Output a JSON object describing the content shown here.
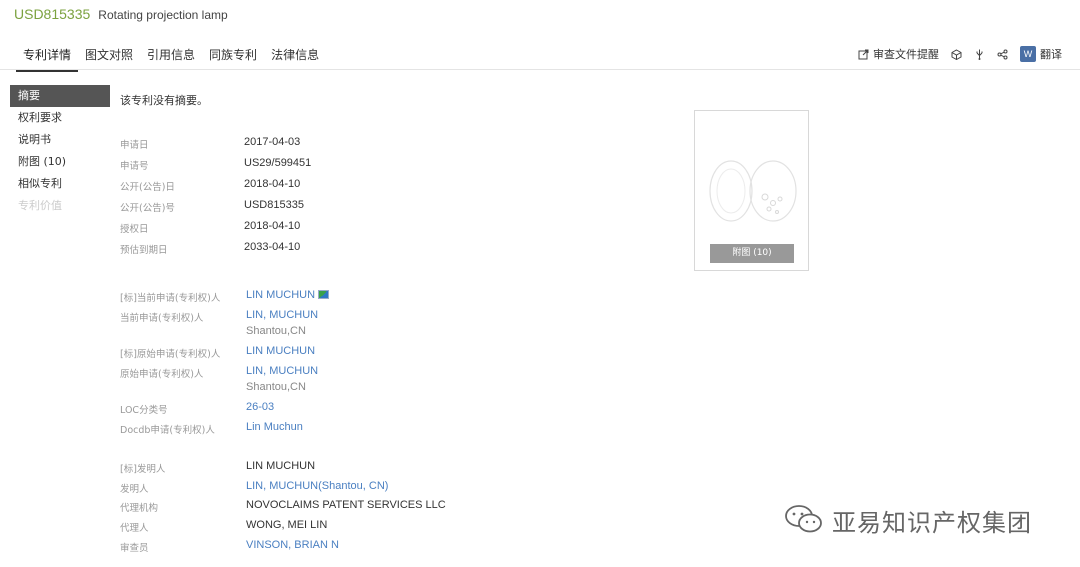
{
  "header": {
    "patent_number": "USD815335",
    "title": "Rotating projection lamp"
  },
  "tabs": [
    "专利详情",
    "图文对照",
    "引用信息",
    "同族专利",
    "法律信息"
  ],
  "tools": {
    "review_alert": "审查文件提醒",
    "translate": "翻译",
    "word_icon_text": "W"
  },
  "sidenav": [
    "摘要",
    "权利要求",
    "说明书",
    "附图 (10)",
    "相似专利",
    "专利价值"
  ],
  "abstract_note": "该专利没有摘要。",
  "dates": [
    {
      "label": "申请日",
      "value": "2017-04-03"
    },
    {
      "label": "申请号",
      "value": "US29/599451"
    },
    {
      "label": "公开(公告)日",
      "value": "2018-04-10"
    },
    {
      "label": "公开(公告)号",
      "value": "USD815335"
    },
    {
      "label": "授权日",
      "value": "2018-04-10"
    },
    {
      "label": "预估到期日",
      "value": "2033-04-10"
    }
  ],
  "parties": {
    "std_current_assignee_label": "[标]当前申请(专利权)人",
    "std_current_assignee": "LIN MUCHUN",
    "current_assignee_label": "当前申请(专利权)人",
    "current_assignee": "LIN, MUCHUN",
    "current_assignee_loc": "Shantou,CN",
    "std_original_assignee_label": "[标]原始申请(专利权)人",
    "std_original_assignee": "LIN MUCHUN",
    "original_assignee_label": "原始申请(专利权)人",
    "original_assignee": "LIN, MUCHUN",
    "original_assignee_loc": "Shantou,CN",
    "loc_label": "LOC分类号",
    "loc": "26-03",
    "docdb_label": "Docdb申请(专利权)人",
    "docdb": "Lin Muchun"
  },
  "people": {
    "std_inventor_label": "[标]发明人",
    "std_inventor": "LIN MUCHUN",
    "inventor_label": "发明人",
    "inventor": "LIN, MUCHUN(Shantou, CN)",
    "agency_label": "代理机构",
    "agency": "NOVOCLAIMS PATENT SERVICES LLC",
    "agent_label": "代理人",
    "agent": "WONG, MEI LIN",
    "examiner_label": "审查员",
    "examiner": "VINSON, BRIAN N"
  },
  "figure": {
    "button_label": "附图 (10)"
  },
  "watermark": {
    "text": "亚易知识产权集团"
  },
  "colors": {
    "accent": "#7ba23f",
    "link": "#4a7fc1",
    "active_nav": "#555555"
  }
}
